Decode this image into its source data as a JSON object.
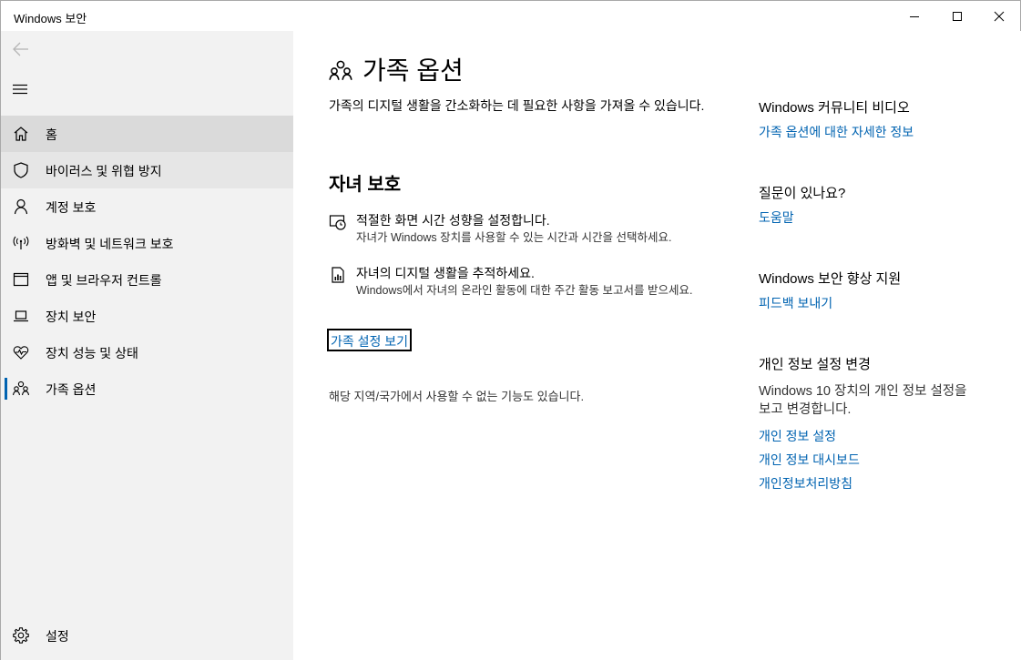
{
  "window": {
    "title": "Windows 보안"
  },
  "sidebar": {
    "items": [
      {
        "label": "홈",
        "icon": "home-icon"
      },
      {
        "label": "바이러스 및 위협 방지",
        "icon": "shield-icon"
      },
      {
        "label": "계정 보호",
        "icon": "person-icon"
      },
      {
        "label": "방화벽 및 네트워크 보호",
        "icon": "antenna-icon"
      },
      {
        "label": "앱 및 브라우저 컨트롤",
        "icon": "window-icon"
      },
      {
        "label": "장치 보안",
        "icon": "laptop-icon"
      },
      {
        "label": "장치 성능 및 상태",
        "icon": "heart-pulse-icon"
      },
      {
        "label": "가족 옵션",
        "icon": "family-icon"
      }
    ],
    "settings_label": "설정"
  },
  "main": {
    "title": "가족 옵션",
    "intro": "가족의 디지털 생활을 간소화하는 데 필요한 사항을 가져올 수 있습니다.",
    "section_title": "자녀 보호",
    "features": [
      {
        "heading": "적절한 화면 시간 성향을 설정합니다.",
        "description": "자녀가 Windows 장치를 사용할 수 있는 시간과 시간을 선택하세요."
      },
      {
        "heading": "자녀의 디지털 생활을 추적하세요.",
        "description": "Windows에서 자녀의 온라인 활동에 대한 주간 활동 보고서를 받으세요."
      }
    ],
    "family_settings_link": "가족 설정 보기",
    "region_note": "해당 지역/국가에서 사용할 수 없는 기능도 있습니다."
  },
  "right": {
    "community": {
      "heading": "Windows 커뮤니티 비디오",
      "link": "가족 옵션에 대한 자세한 정보"
    },
    "question": {
      "heading": "질문이 있나요?",
      "link": "도움말"
    },
    "improve": {
      "heading": "Windows 보안 향상 지원",
      "link": "피드백 보내기"
    },
    "privacy": {
      "heading": "개인 정보 설정 변경",
      "text": "Windows 10 장치의 개인 정보 설정을 보고 변경합니다.",
      "links": [
        "개인 정보 설정",
        "개인 정보 대시보드",
        "개인정보처리방침"
      ]
    }
  },
  "colors": {
    "accent": "#0063b1",
    "sidebar_bg": "#f2f2f2",
    "selected_bg": "#dadada"
  }
}
